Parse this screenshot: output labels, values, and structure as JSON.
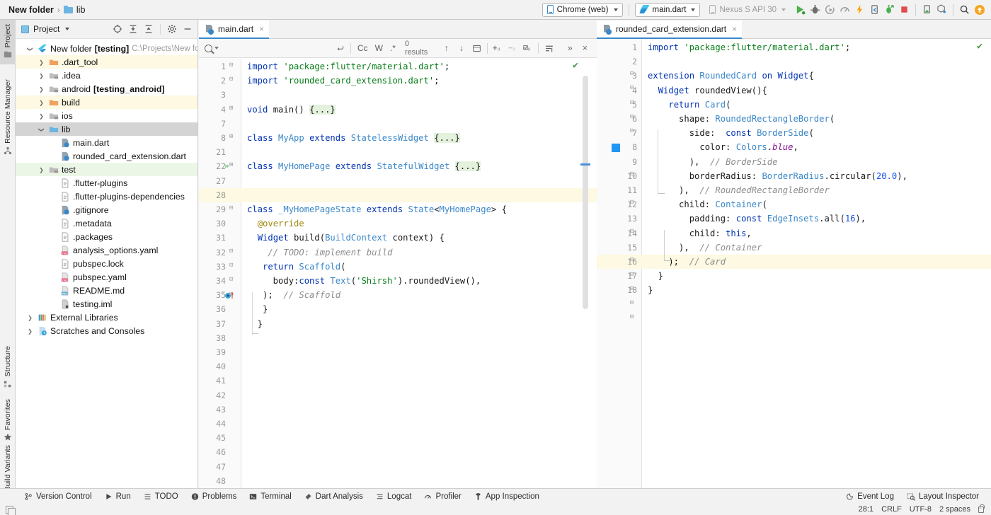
{
  "topbar": {
    "breadcrumb_root": "New folder",
    "breadcrumb_sep": "›",
    "breadcrumb_item": "lib",
    "device_combo": "Chrome (web)",
    "config_combo": "main.dart",
    "emulator_combo": "Nexus S API 30",
    "icons": [
      "run-icon",
      "debug-icon",
      "run-coverage-icon",
      "profile-icon",
      "hot-reload-icon",
      "flutter-inspect-icon",
      "attach-debugger-icon",
      "stop-icon",
      "device-manager-icon",
      "package-download-icon",
      "search-everywhere-icon",
      "update-icon"
    ]
  },
  "rail": {
    "items": [
      {
        "label": "Project",
        "active": true
      },
      {
        "label": "Resource Manager",
        "active": false
      },
      {
        "label": "Structure",
        "active": false
      },
      {
        "label": "Favorites",
        "active": false
      },
      {
        "label": "Build Variants",
        "active": false
      }
    ]
  },
  "project": {
    "title": "Project",
    "tools": [
      "locate-icon",
      "expand-all-icon",
      "collapse-all-icon",
      "settings-icon",
      "hide-icon"
    ],
    "tree": [
      {
        "indent": 0,
        "arrow": "d",
        "icon": "flutter",
        "label": "New folder",
        "bold": " [testing]",
        "path": "C:\\Projects\\New folder",
        "hl": ""
      },
      {
        "indent": 1,
        "arrow": "r",
        "icon": "folder-orange",
        "label": ".dart_tool",
        "bold": "",
        "path": "",
        "hl": "yellow"
      },
      {
        "indent": 1,
        "arrow": "r",
        "icon": "folder-grey",
        "label": ".idea",
        "bold": "",
        "path": "",
        "hl": ""
      },
      {
        "indent": 1,
        "arrow": "r",
        "icon": "folder-grey",
        "label": "android",
        "bold": " [testing_android]",
        "path": "",
        "hl": ""
      },
      {
        "indent": 1,
        "arrow": "r",
        "icon": "folder-orange",
        "label": "build",
        "bold": "",
        "path": "",
        "hl": "yellow"
      },
      {
        "indent": 1,
        "arrow": "r",
        "icon": "folder-grey",
        "label": "ios",
        "bold": "",
        "path": "",
        "hl": ""
      },
      {
        "indent": 1,
        "arrow": "d",
        "icon": "folder-blue",
        "label": "lib",
        "bold": "",
        "path": "",
        "hl": "sel"
      },
      {
        "indent": 2,
        "arrow": "",
        "icon": "dart",
        "label": "main.dart",
        "bold": "",
        "path": "",
        "hl": ""
      },
      {
        "indent": 2,
        "arrow": "",
        "icon": "dart",
        "label": "rounded_card_extension.dart",
        "bold": "",
        "path": "",
        "hl": ""
      },
      {
        "indent": 1,
        "arrow": "r",
        "icon": "folder-grey",
        "label": "test",
        "bold": "",
        "path": "",
        "hl": "green"
      },
      {
        "indent": 2,
        "arrow": "",
        "icon": "file",
        "label": ".flutter-plugins",
        "bold": "",
        "path": "",
        "hl": ""
      },
      {
        "indent": 2,
        "arrow": "",
        "icon": "file",
        "label": ".flutter-plugins-dependencies",
        "bold": "",
        "path": "",
        "hl": ""
      },
      {
        "indent": 2,
        "arrow": "",
        "icon": "dart",
        "label": ".gitignore",
        "bold": "",
        "path": "",
        "hl": ""
      },
      {
        "indent": 2,
        "arrow": "",
        "icon": "file",
        "label": ".metadata",
        "bold": "",
        "path": "",
        "hl": ""
      },
      {
        "indent": 2,
        "arrow": "",
        "icon": "file",
        "label": ".packages",
        "bold": "",
        "path": "",
        "hl": ""
      },
      {
        "indent": 2,
        "arrow": "",
        "icon": "yaml",
        "label": "analysis_options.yaml",
        "bold": "",
        "path": "",
        "hl": ""
      },
      {
        "indent": 2,
        "arrow": "",
        "icon": "file",
        "label": "pubspec.lock",
        "bold": "",
        "path": "",
        "hl": ""
      },
      {
        "indent": 2,
        "arrow": "",
        "icon": "yaml",
        "label": "pubspec.yaml",
        "bold": "",
        "path": "",
        "hl": ""
      },
      {
        "indent": 2,
        "arrow": "",
        "icon": "md",
        "label": "README.md",
        "bold": "",
        "path": "",
        "hl": ""
      },
      {
        "indent": 2,
        "arrow": "",
        "icon": "iml",
        "label": "testing.iml",
        "bold": "",
        "path": "",
        "hl": ""
      },
      {
        "indent": 0,
        "arrow": "r",
        "icon": "libs",
        "label": "External Libraries",
        "bold": "",
        "path": "",
        "hl": ""
      },
      {
        "indent": 0,
        "arrow": "r",
        "icon": "scratch",
        "label": "Scratches and Consoles",
        "bold": "",
        "path": "",
        "hl": ""
      }
    ]
  },
  "editor_left": {
    "tab": "main.dart",
    "close_label": "×",
    "find": {
      "placeholder": "",
      "value": "",
      "results": "0 results",
      "match_case": "Cc",
      "words": "W",
      "regex": ".*",
      "prev": "↑",
      "next": "↓",
      "more": "»",
      "close": "×"
    },
    "lines": [
      {
        "n": "1",
        "code": "import 'package:flutter/material.dart';"
      },
      {
        "n": "2",
        "code": "import 'rounded_card_extension.dart';"
      },
      {
        "n": "3",
        "code": ""
      },
      {
        "n": "4",
        "code": "void main() {...}"
      },
      {
        "n": "7",
        "code": ""
      },
      {
        "n": "8",
        "code": "class MyApp extends StatelessWidget {...}"
      },
      {
        "n": "21",
        "code": ""
      },
      {
        "n": "22",
        "code": "class MyHomePage extends StatefulWidget {...}"
      },
      {
        "n": "27",
        "code": ""
      },
      {
        "n": "28",
        "code": ""
      },
      {
        "n": "29",
        "code": "class _MyHomePageState extends State<MyHomePage> {"
      },
      {
        "n": "30",
        "code": "  @override"
      },
      {
        "n": "31",
        "code": "  Widget build(BuildContext context) {"
      },
      {
        "n": "32",
        "code": "    // TODO: implement build"
      },
      {
        "n": "33",
        "code": "   return Scaffold("
      },
      {
        "n": "34",
        "code": "     body:const Text('Shirsh').roundedView(),"
      },
      {
        "n": "35",
        "code": "   );  // Scaffold"
      },
      {
        "n": "36",
        "code": "   }"
      },
      {
        "n": "37",
        "code": "  }"
      },
      {
        "n": "38",
        "code": ""
      },
      {
        "n": "39",
        "code": ""
      },
      {
        "n": "40",
        "code": ""
      },
      {
        "n": "41",
        "code": ""
      },
      {
        "n": "42",
        "code": ""
      },
      {
        "n": "43",
        "code": ""
      },
      {
        "n": "44",
        "code": ""
      },
      {
        "n": "45",
        "code": ""
      },
      {
        "n": "46",
        "code": ""
      },
      {
        "n": "47",
        "code": ""
      },
      {
        "n": "48",
        "code": ""
      }
    ]
  },
  "editor_right": {
    "tab": "rounded_card_extension.dart",
    "close_label": "×",
    "lines": [
      {
        "n": "1",
        "code": "import 'package:flutter/material.dart';"
      },
      {
        "n": "2",
        "code": ""
      },
      {
        "n": "3",
        "code": "extension RoundedCard on Widget{"
      },
      {
        "n": "4",
        "code": "  Widget roundedView(){"
      },
      {
        "n": "5",
        "code": "    return Card("
      },
      {
        "n": "6",
        "code": "      shape: RoundedRectangleBorder("
      },
      {
        "n": "7",
        "code": "        side:  const BorderSide("
      },
      {
        "n": "8",
        "code": "          color: Colors.blue,"
      },
      {
        "n": "9",
        "code": "        ),  // BorderSide"
      },
      {
        "n": "10",
        "code": "        borderRadius: BorderRadius.circular(20.0),"
      },
      {
        "n": "11",
        "code": "      ),  // RoundedRectangleBorder"
      },
      {
        "n": "12",
        "code": "      child: Container("
      },
      {
        "n": "13",
        "code": "        padding: const EdgeInsets.all(16),"
      },
      {
        "n": "14",
        "code": "        child: this,"
      },
      {
        "n": "15",
        "code": "      ),  // Container"
      },
      {
        "n": "16",
        "code": "    );  // Card"
      },
      {
        "n": "17",
        "code": "  }"
      },
      {
        "n": "18",
        "code": "}"
      }
    ]
  },
  "bottombar": {
    "items": [
      {
        "label": "Version Control",
        "icon": "branch-icon"
      },
      {
        "label": "Run",
        "icon": "play-icon"
      },
      {
        "label": "TODO",
        "icon": "list-icon"
      },
      {
        "label": "Problems",
        "icon": "error-icon"
      },
      {
        "label": "Terminal",
        "icon": "terminal-icon"
      },
      {
        "label": "Dart Analysis",
        "icon": "dart-icon"
      },
      {
        "label": "Logcat",
        "icon": "logcat-icon"
      },
      {
        "label": "Profiler",
        "icon": "profiler-icon"
      },
      {
        "label": "App Inspection",
        "icon": "inspection-icon"
      }
    ],
    "right": [
      {
        "label": "Event Log",
        "icon": "event-log-icon"
      },
      {
        "label": "Layout Inspector",
        "icon": "layout-inspector-icon"
      }
    ]
  },
  "statusbar": {
    "caret": "28:1",
    "line_sep": "CRLF",
    "encoding": "UTF-8",
    "indent": "2 spaces",
    "lock_icon": "lock-icon"
  },
  "colors": {
    "accent": "#3a87c8",
    "keyword": "#0033b3",
    "string": "#067d17",
    "comment": "#8c8c8c",
    "chrome": "#f2f2f2",
    "highlight_line": "#fdf9e2"
  }
}
